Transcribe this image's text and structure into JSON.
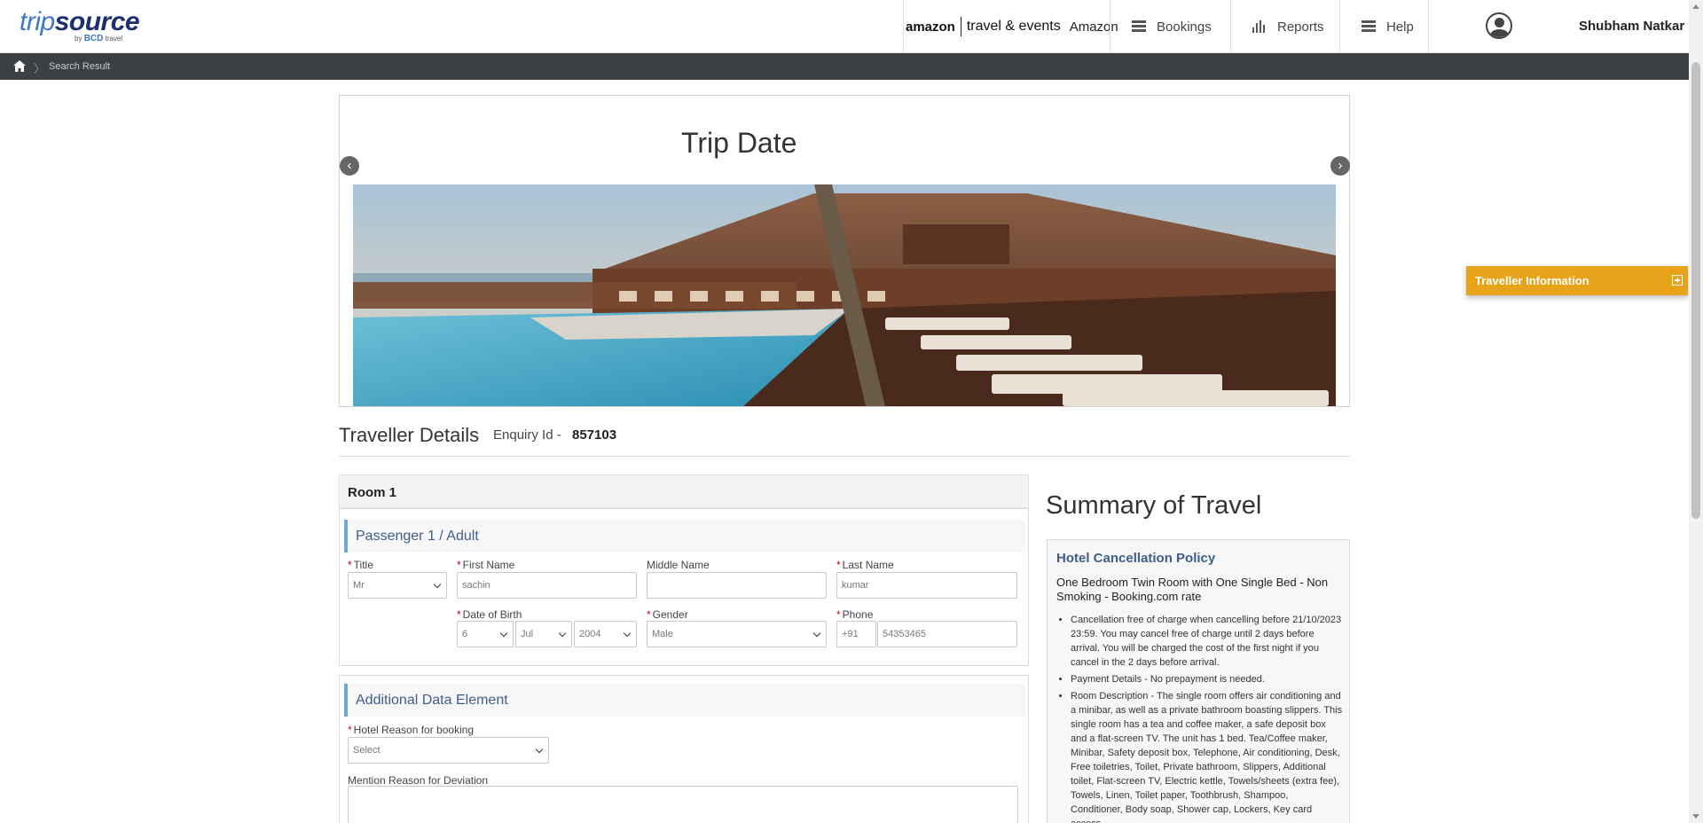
{
  "header": {
    "logo_trip": "trip",
    "logo_source": "source",
    "logo_by": "by",
    "logo_bcd": "BCD",
    "logo_travel": "travel",
    "client_brand": "amazon",
    "client_sub": "travel & events",
    "client_name": "Amazon",
    "nav": [
      {
        "label": "Bookings",
        "icon": "list-icon"
      },
      {
        "label": "Reports",
        "icon": "bar-chart-icon"
      },
      {
        "label": "Help",
        "icon": "list-icon"
      }
    ],
    "user_name": "Shubham Natkar"
  },
  "breadcrumb": {
    "current": "Search Result"
  },
  "trip": {
    "title": "Trip Date",
    "prev": "‹",
    "next": "›"
  },
  "traveller": {
    "title": "Traveller Details",
    "enquiry_label": "Enquiry Id -",
    "enquiry_id": "857103"
  },
  "room": {
    "title": "Room 1",
    "passenger_heading": "Passenger 1 / Adult",
    "fields": {
      "title_label": "Title",
      "title_value": "Mr",
      "first_name_label": "First Name",
      "first_name_value": "sachin",
      "middle_name_label": "Middle Name",
      "middle_name_value": "",
      "last_name_label": "Last Name",
      "last_name_value": "kumar",
      "dob_label": "Date of Birth",
      "dob_day": "6",
      "dob_month": "Jul",
      "dob_year": "2004",
      "gender_label": "Gender",
      "gender_value": "Male",
      "phone_label": "Phone",
      "phone_code": "+91",
      "phone_value": "54353465"
    }
  },
  "additional": {
    "heading": "Additional Data Element",
    "reason_label": "Hotel Reason for booking",
    "reason_placeholder": "Select",
    "deviation_label": "Mention Reason for Deviation"
  },
  "summary": {
    "title": "Summary of Travel",
    "policy_title": "Hotel Cancellation Policy",
    "room_name": "One Bedroom Twin Room with One Single Bed - Non Smoking - Booking.com rate",
    "items": [
      "Cancellation free of charge when cancelling before 21/10/2023 23:59. You may cancel free of charge until 2 days before arrival. You will be charged the cost of the first night if you cancel in the 2 days before arrival.",
      "Payment Details - No prepayment is needed.",
      "Room Description - The single room offers air conditioning and a minibar, as well as a private bathroom boasting slippers. This single room has a tea and coffee maker, a safe deposit box and a flat-screen TV. The unit has 1 bed. Tea/Coffee maker, Minibar, Safety deposit box, Telephone, Air conditioning, Desk, Free toiletries, Toilet, Private bathroom, Slippers, Additional toilet, Flat-screen TV, Electric kettle, Towels/sheets (extra fee), Towels, Linen, Toilet paper, Toothbrush, Shampoo, Conditioner, Body soap, Shower cap, Lockers, Key card access"
    ]
  },
  "traveller_info_tab": {
    "label": "Traveller Information"
  },
  "colors": {
    "accent": "#e7a31a",
    "heading_blue": "#3e5e88",
    "breadcrumb_bg": "#3c4043"
  }
}
